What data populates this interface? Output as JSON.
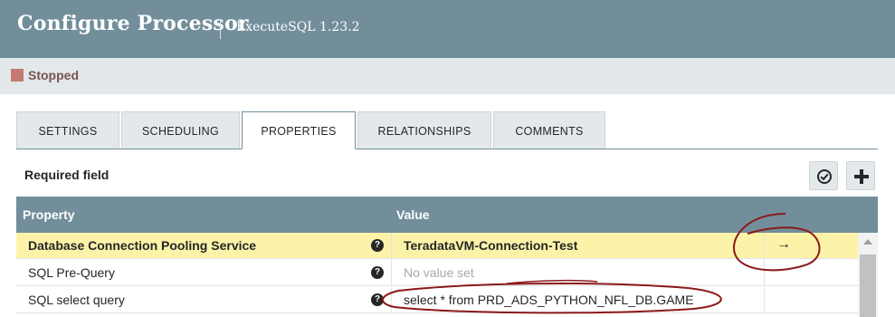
{
  "header": {
    "title": "Configure Processor",
    "subtitle": "ExecuteSQL 1.23.2"
  },
  "status": {
    "text": "Stopped",
    "color": "#ba554a"
  },
  "tabs": [
    {
      "label": "SETTINGS",
      "active": false
    },
    {
      "label": "SCHEDULING",
      "active": false
    },
    {
      "label": "PROPERTIES",
      "active": true
    },
    {
      "label": "RELATIONSHIPS",
      "active": false
    },
    {
      "label": "COMMENTS",
      "active": false
    }
  ],
  "properties": {
    "required_label": "Required field",
    "verify_icon": "check-circle-icon",
    "add_icon": "plus-icon",
    "columns": {
      "property": "Property",
      "value": "Value"
    },
    "rows": [
      {
        "property": "Database Connection Pooling Service",
        "help": "?",
        "value": "TeradataVM-Connection-Test",
        "highlight": true,
        "action": "→"
      },
      {
        "property": "SQL Pre-Query",
        "help": "?",
        "value": "No value set",
        "highlight": false,
        "action": ""
      },
      {
        "property": "SQL select query",
        "help": "?",
        "value": "select * from PRD_ADS_PYTHON_NFL_DB.GAME",
        "highlight": false,
        "action": ""
      }
    ]
  },
  "colors": {
    "header_bg": "#728e9b",
    "status_bg": "#e3e8eb",
    "highlight_row": "#fcf3a8",
    "annotation": "#8b1a1a"
  }
}
